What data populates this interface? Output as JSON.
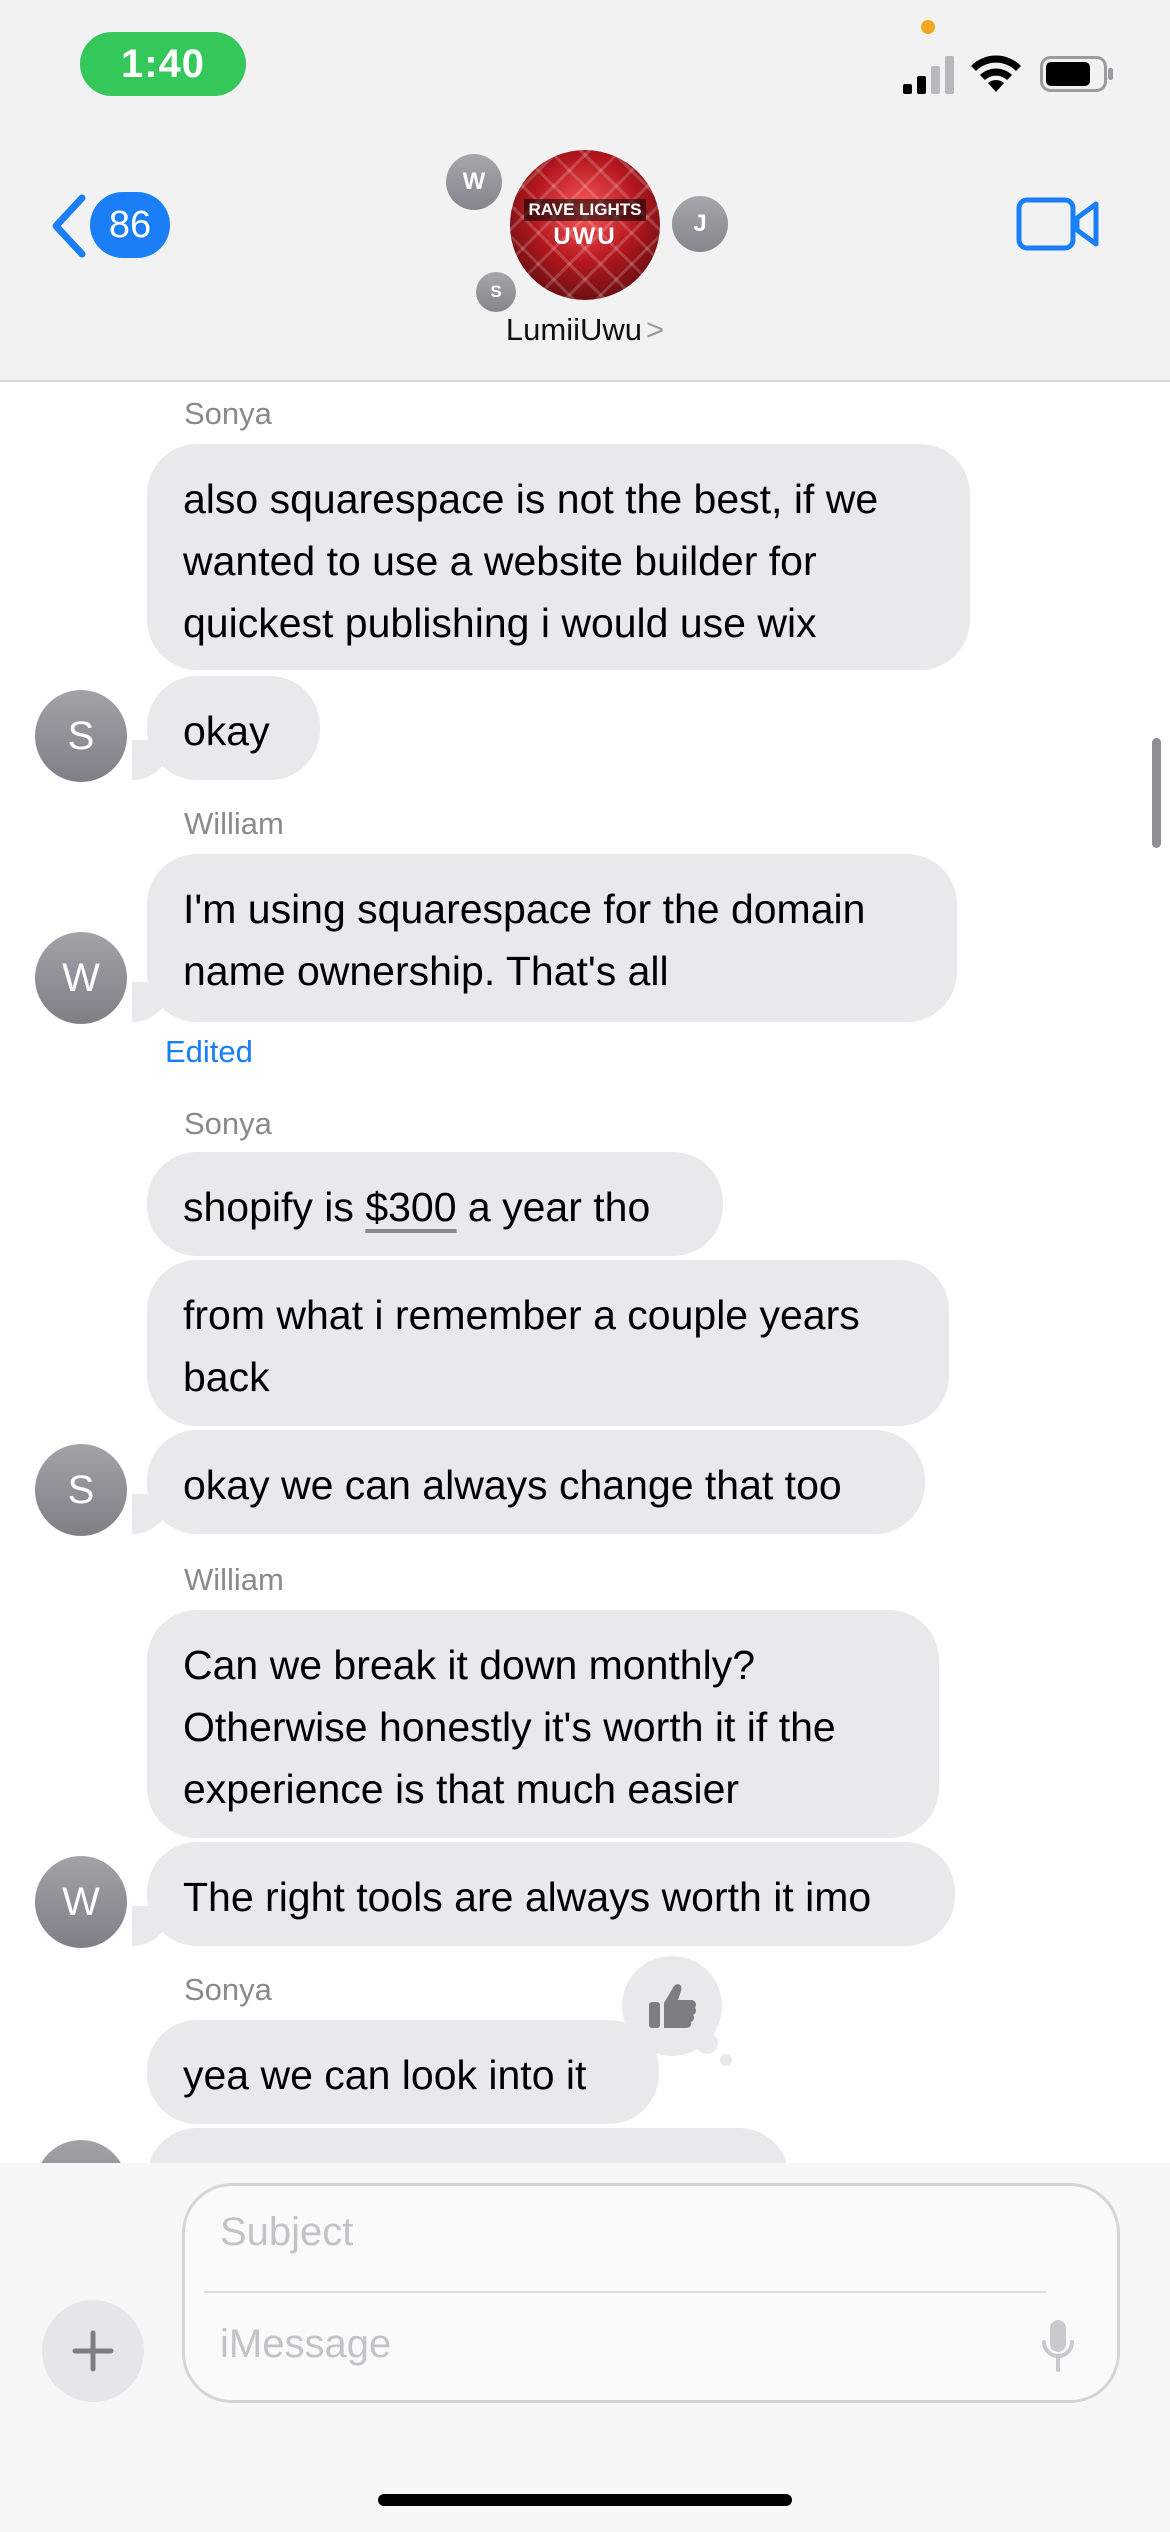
{
  "status_bar": {
    "time": "1:40"
  },
  "header": {
    "back_count": "86",
    "group_name": "LumiiUwu",
    "group_name_chevron": ">",
    "group_avatar_text_top": "RAVE LIGHTS",
    "group_avatar_text_bottom": "UWU",
    "participants": [
      "W",
      "J",
      "S"
    ]
  },
  "messages": [
    {
      "sender": "Sonya",
      "text": "also squarespace is not the best, if we wanted to use a website builder for quickest publishing i would use wix"
    },
    {
      "text": "okay",
      "avatar": "S"
    },
    {
      "sender": "William",
      "text": "I'm using squarespace for the domain name ownership. That's all",
      "avatar": "W",
      "status": "Edited"
    },
    {
      "sender": "Sonya",
      "text_before": "shopify is ",
      "text_link": "$300",
      "text_after": " a year tho"
    },
    {
      "text": "from what i remember a couple years back"
    },
    {
      "text": "okay we can always change that too",
      "avatar": "S"
    },
    {
      "sender": "William",
      "text": "Can we break it down monthly? Otherwise honestly it's worth it if the experience is that much easier"
    },
    {
      "text": "The right tools are always worth it imo",
      "avatar": "W"
    },
    {
      "sender": "Sonya",
      "text": "yea we can look into it",
      "reaction": "thumbs-up"
    }
  ],
  "composer": {
    "subject_placeholder": "Subject",
    "message_placeholder": "iMessage"
  },
  "colors": {
    "accent": "#1a7ef7",
    "bubble_gray": "#e9e9eb",
    "status_green": "#34c759"
  }
}
